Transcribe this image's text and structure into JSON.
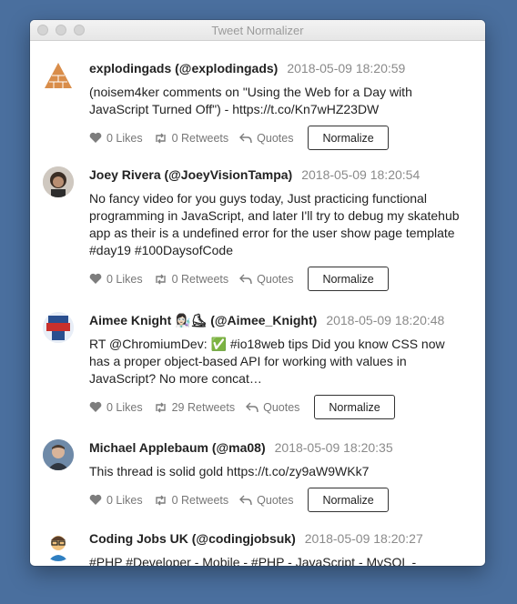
{
  "window": {
    "title": "Tweet Normalizer"
  },
  "normalize_label": "Normalize",
  "tweets": [
    {
      "author": "explodingads (@explodingads)",
      "time": "2018-05-09 18:20:59",
      "text": "(noisem4ker comments on \"Using the Web for a Day with JavaScript Turned Off\") - https://t.co/Kn7wHZ23DW",
      "likes": "0 Likes",
      "retweets": "0 Retweets",
      "quotes": "Quotes"
    },
    {
      "author": "Joey Rivera (@JoeyVisionTampa)",
      "time": "2018-05-09 18:20:54",
      "text": "No fancy video for you guys today, Just practicing functional programming in JavaScript, and later I'll try to debug my skatehub app as their is a undefined error for the user show page template #day19 #100DaysofCode",
      "likes": "0 Likes",
      "retweets": "0 Retweets",
      "quotes": "Quotes"
    },
    {
      "author": "Aimee Knight 👩🏻‍🔬⛸ (@Aimee_Knight)",
      "time": "2018-05-09 18:20:48",
      "text": "RT @ChromiumDev: ✅ #io18web tips Did you know CSS now has a proper object-based API for working with values in JavaScript? No more concat…",
      "likes": "0 Likes",
      "retweets": "29 Retweets",
      "quotes": "Quotes"
    },
    {
      "author": "Michael Applebaum (@ma08)",
      "time": "2018-05-09 18:20:35",
      "text": "This thread is solid gold https://t.co/zy9aW9WKk7",
      "likes": "0 Likes",
      "retweets": "0 Retweets",
      "quotes": "Quotes"
    },
    {
      "author": "Coding Jobs UK (@codingjobsuk)",
      "time": "2018-05-09 18:20:27",
      "text": "#PHP #Developer - Mobile - #PHP - JavaScript - MySQL -"
    }
  ]
}
